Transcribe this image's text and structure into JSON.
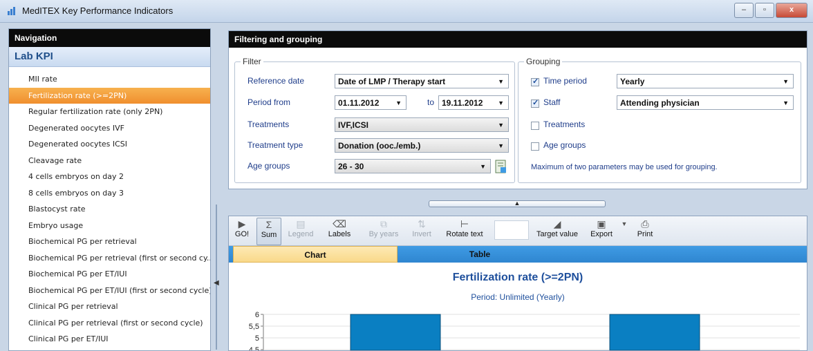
{
  "window": {
    "title": "MedITEX Key Performance Indicators",
    "buttons": [
      "–",
      "▫",
      "x"
    ]
  },
  "nav": {
    "header": "Navigation",
    "section": "Lab KPI",
    "items": [
      "MII rate",
      "Fertilization rate (>=2PN)",
      "Regular fertilization rate (only 2PN)",
      "Degenerated oocytes IVF",
      "Degenerated oocytes ICSI",
      "Cleavage rate",
      "4 cells embryos on day 2",
      "8 cells embryos on day 3",
      "Blastocyst rate",
      "Embryo usage",
      "Biochemical PG per retrieval",
      "Biochemical PG per retrieval (first or second cy...",
      "Biochemical PG per ET/IUI",
      "Biochemical PG per ET/IUI (first or second cycle)",
      "Clinical PG per retrieval",
      "Clinical PG per retrieval (first or second cycle)",
      "Clinical PG per ET/IUI"
    ],
    "active_index": 1
  },
  "filtering": {
    "header": "Filtering and grouping",
    "filter": {
      "title": "Filter",
      "reference_date_label": "Reference date",
      "reference_date_value": "Date of LMP / Therapy start",
      "period_from_label": "Period from",
      "period_from_value": "01.11.2012",
      "to_label": "to",
      "period_to_value": "19.11.2012",
      "treatments_label": "Treatments",
      "treatments_value": "IVF,ICSI",
      "treatment_type_label": "Treatment type",
      "treatment_type_value": "Donation (ooc./emb.)",
      "age_groups_label": "Age groups",
      "age_groups_value": "26 - 30"
    },
    "grouping": {
      "title": "Grouping",
      "time_period_label": "Time period",
      "time_period_value": "Yearly",
      "time_period_checked": true,
      "staff_label": "Staff",
      "staff_value": "Attending physician",
      "staff_checked": true,
      "treatments_label": "Treatments",
      "treatments_checked": false,
      "age_groups_label": "Age groups",
      "age_groups_checked": false,
      "hint": "Maximum of two parameters may be used for grouping."
    }
  },
  "toolbar": {
    "go": "GO!",
    "sum": "Sum",
    "legend": "Legend",
    "labels": "Labels",
    "by_years": "By years",
    "invert": "Invert",
    "rotate_text": "Rotate text",
    "target_value": "Target value",
    "export": "Export",
    "print": "Print"
  },
  "tabs": {
    "chart": "Chart",
    "table": "Table"
  },
  "colors": {
    "bar": "#0a7fc2",
    "accent": "#1e4f9c",
    "active_item": "#f39a36"
  },
  "chart_data": {
    "type": "bar",
    "title": "Fertilization rate (>=2PN)",
    "subtitle": "Period: Unlimited (Yearly)",
    "y_ticks": [
      "6",
      "5,5",
      "5",
      "4,5"
    ],
    "categories": [
      "",
      ""
    ],
    "values": [
      6,
      6
    ],
    "ylim": [
      4.5,
      6
    ]
  }
}
